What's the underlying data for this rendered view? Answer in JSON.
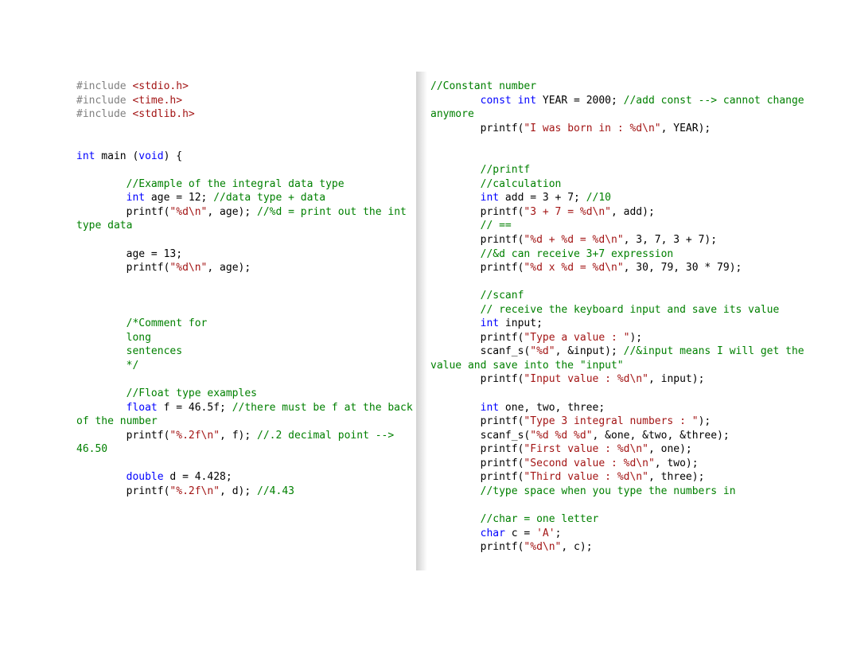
{
  "left": {
    "pp1": "#include ",
    "inc1": "<stdio.h>",
    "pp2": "#include ",
    "inc2": "<time.h>",
    "pp3": "#include ",
    "inc3": "<stdlib.h>",
    "kw_int1": "int",
    "main_sig1": " main (",
    "kw_void": "void",
    "main_sig2": ") {",
    "cmt_ex": "//Example of the integral data type",
    "kw_int2": "int",
    "age_decl": " age = 12; ",
    "cmt_datatype": "//data type + data",
    "printf1a": "printf(",
    "str_d1": "\"%d\\n\"",
    "printf1b": ", age); ",
    "cmt_printd": "//%d = print out the int type data",
    "age13": "age = 13;",
    "printf2a": "printf(",
    "str_d2": "\"%d\\n\"",
    "printf2b": ", age);",
    "cmt_block": "/*Comment for\n\tlong\n\tsentences\n\t*/",
    "cmt_float": "//Float type examples",
    "kw_float": "float",
    "float_decl": " f = 46.5f; ",
    "cmt_floatback": "//there must be f at the back of the number",
    "printf3a": "printf(",
    "str_f1": "\"%.2f\\n\"",
    "printf3b": ", f); ",
    "cmt_dec": "//.2 decimal point --> 46.50",
    "kw_double": "double",
    "double_decl": " d = 4.428;",
    "printf4a": "printf(",
    "str_f2": "\"%.2f\\n\"",
    "printf4b": ", d); ",
    "cmt_443": "//4.43"
  },
  "right": {
    "cmt_const": "//Constant number",
    "kw_const": "const",
    "kw_int_y": "int",
    "year_decl": " YEAR = 2000; ",
    "cmt_addconst": "//add const --> cannot change anymore",
    "printf_y_a": "printf(",
    "str_born": "\"I was born in : %d\\n\"",
    "printf_y_b": ", YEAR);",
    "cmt_printf": "//printf",
    "cmt_calc": "//calculation",
    "kw_int_add": "int",
    "add_decl": " add = 3 + 7; ",
    "cmt_10": "//10",
    "printf_add_a": "printf(",
    "str_37": "\"3 + 7 = %d\\n\"",
    "printf_add_b": ", add);",
    "cmt_eq": "// ==",
    "printf_sum_a": "printf(",
    "str_sum": "\"%d + %d = %d\\n\"",
    "printf_sum_b": ", 3, 7, 3 + 7);",
    "cmt_expr": "//&d can receive 3+7 expression",
    "printf_mul_a": "printf(",
    "str_mul": "\"%d x %d = %d\\n\"",
    "printf_mul_b": ", 30, 79, 30 * 79);",
    "cmt_scanf": "//scanf",
    "cmt_recv": "// receive the keyboard input and save its value",
    "kw_int_input": "int",
    "input_decl": " input;",
    "printf_tv_a": "printf(",
    "str_typeval": "\"Type a value : \"",
    "printf_tv_b": ");",
    "scanf1a": "scanf_s(",
    "str_pd": "\"%d\"",
    "scanf1b": ", &input); ",
    "cmt_amp": "//&input means I will get the value and save into the \"input\"",
    "printf_iv_a": "printf(",
    "str_inputval": "\"Input value : %d\\n\"",
    "printf_iv_b": ", input);",
    "kw_int_ott": "int",
    "ott_decl": " one, two, three;",
    "printf_t3_a": "printf(",
    "str_type3": "\"Type 3 integral numbers : \"",
    "printf_t3_b": ");",
    "scanf3a": "scanf_s(",
    "str_ddd": "\"%d %d %d\"",
    "scanf3b": ", &one, &two, &three);",
    "printf_fv_a": "printf(",
    "str_first": "\"First value : %d\\n\"",
    "printf_fv_b": ", one);",
    "printf_sv_a": "printf(",
    "str_second": "\"Second value : %d\\n\"",
    "printf_sv_b": ", two);",
    "printf_thv_a": "printf(",
    "str_third": "\"Third value : %d\\n\"",
    "printf_thv_b": ", three);",
    "cmt_space": "//type space when you type the numbers in",
    "cmt_char": "//char = one letter",
    "kw_char": "char",
    "char_decl": " c = ",
    "char_lit": "'A'",
    "char_end": ";",
    "printf_c_a": "printf(",
    "str_dc": "\"%d\\n\"",
    "printf_c_b": ", c);"
  }
}
